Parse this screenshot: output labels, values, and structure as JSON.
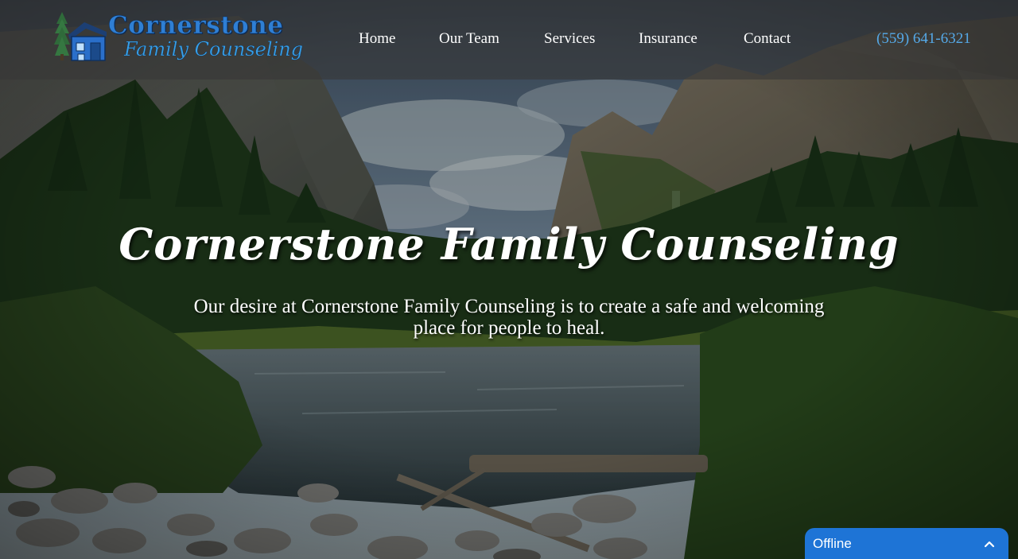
{
  "brand": {
    "title": "Cornerstone",
    "subtitle": "Family Counseling",
    "title_color": "#2f7fd4",
    "subtitle_color": "#38a0e8"
  },
  "nav": {
    "items": [
      {
        "label": "Home"
      },
      {
        "label": "Our Team"
      },
      {
        "label": "Services"
      },
      {
        "label": "Insurance"
      },
      {
        "label": "Contact"
      }
    ]
  },
  "phone": {
    "label": "(559) 641-6321",
    "color": "#55a9e8"
  },
  "hero": {
    "title": "Cornerstone Family Counseling",
    "text": "Our desire at Cornerstone Family Counseling is to create a safe and welcoming place for people to heal."
  },
  "chat": {
    "status": "Offline",
    "color": "#1e74d6",
    "toggle_icon": "chevron-up-icon"
  }
}
